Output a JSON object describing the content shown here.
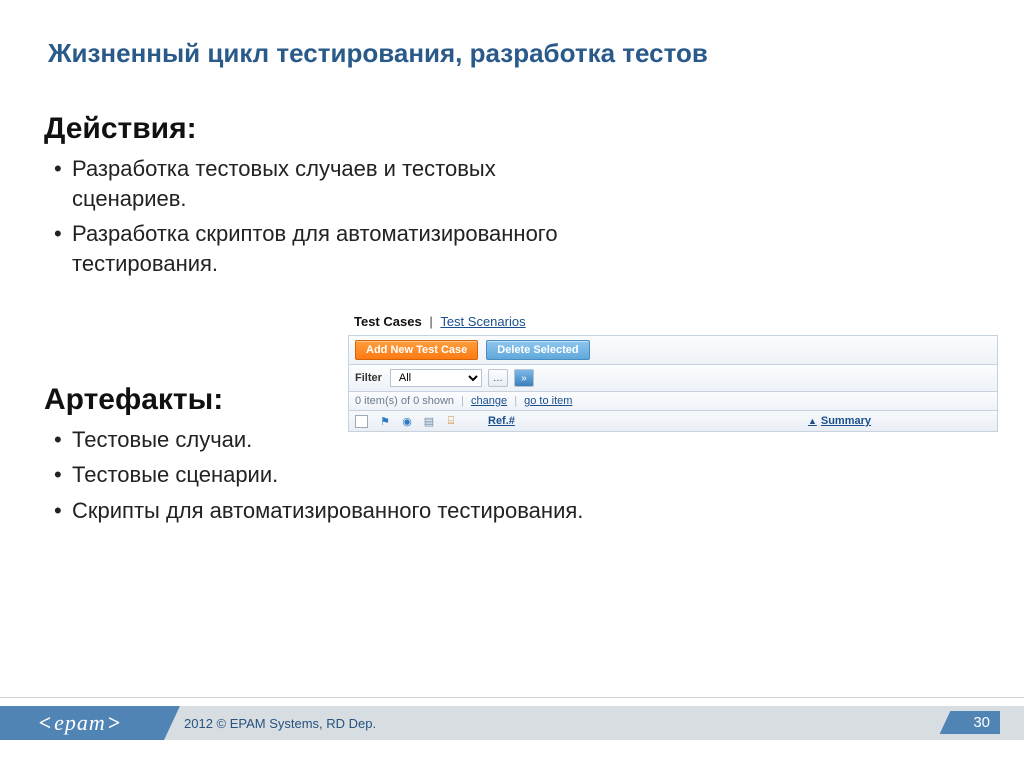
{
  "title": "Жизненный цикл тестирования, разработка тестов",
  "sections": {
    "actions": {
      "heading": "Действия:",
      "items": [
        "Разработка тестовых случаев и тестовых сценариев.",
        "Разработка скриптов для автоматизированного тестирования."
      ]
    },
    "artifacts": {
      "heading": "Артефакты:",
      "items": [
        "Тестовые случаи.",
        "Тестовые сценарии.",
        "Скрипты для автоматизированного тестирования."
      ]
    }
  },
  "ui": {
    "tabs": [
      "Test Cases",
      "Test Scenarios"
    ],
    "tab_sep": "|",
    "buttons": {
      "add": "Add New Test Case",
      "delete": "Delete Selected"
    },
    "filter": {
      "label": "Filter",
      "value": "All"
    },
    "status": {
      "count": "0 item(s) of 0 shown",
      "change": "change",
      "goto": "go to item"
    },
    "columns": {
      "ref": "Ref.#",
      "summary": "Summary"
    }
  },
  "footer": {
    "logo": "epam",
    "copyright": "2012 © EPAM Systems, RD Dep.",
    "page": "30"
  }
}
